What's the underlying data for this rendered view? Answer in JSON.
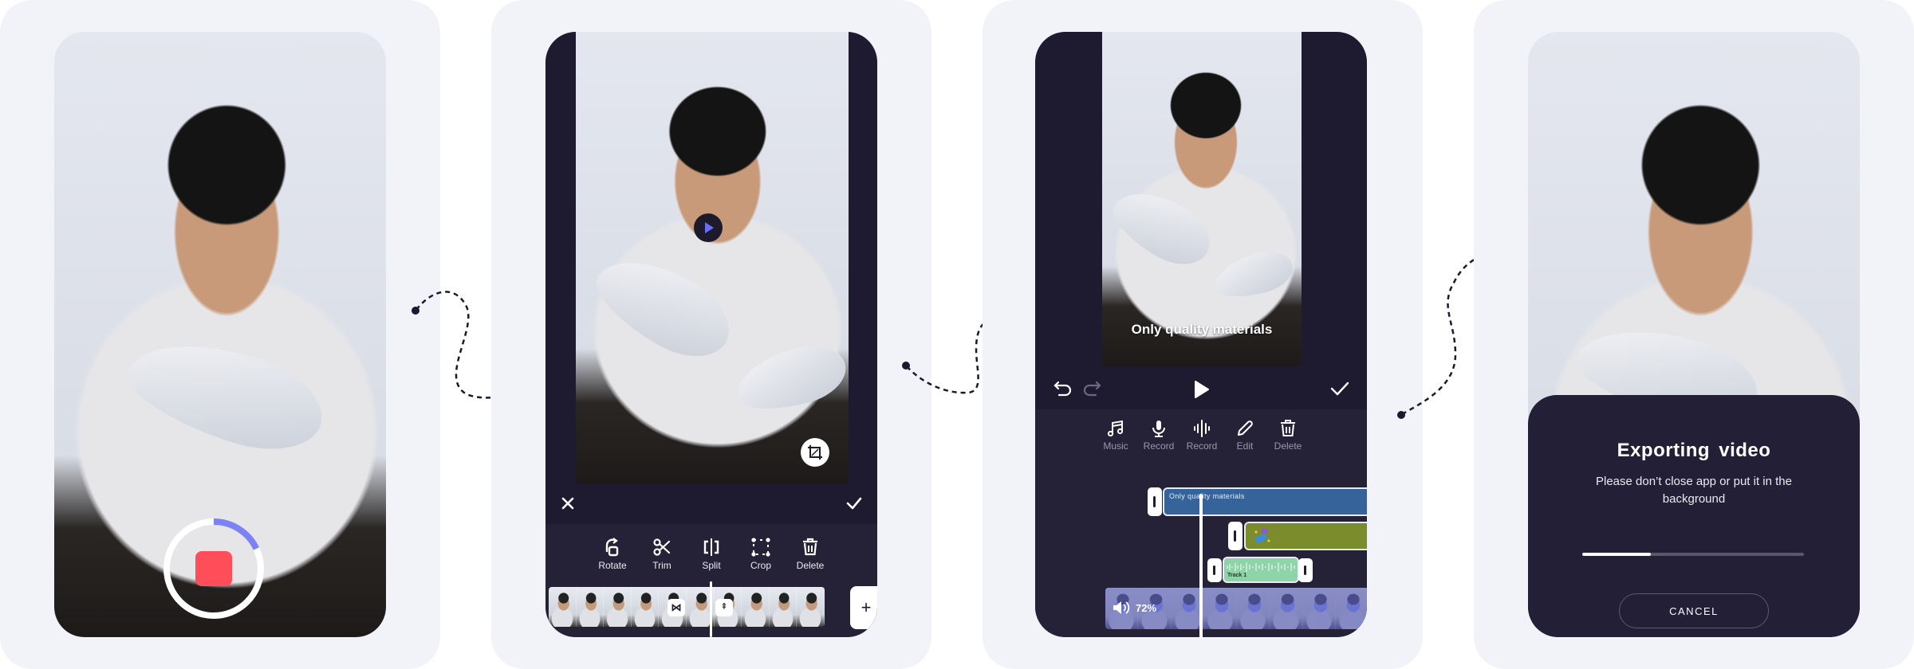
{
  "screens": {
    "record": {
      "recording_progress": 0.18,
      "colors": {
        "stop": "#ff4d5a",
        "ring": "#ffffff",
        "progress": "#7b82f5"
      }
    },
    "edit": {
      "tools": [
        {
          "icon": "rotate-icon",
          "label": "Rotate"
        },
        {
          "icon": "scissors-icon",
          "label": "Trim"
        },
        {
          "icon": "split-icon",
          "label": "Split"
        },
        {
          "icon": "crop-icon",
          "label": "Crop"
        },
        {
          "icon": "trash-icon",
          "label": "Delete"
        }
      ],
      "add_label": "+"
    },
    "audio": {
      "caption": "Only quality materials",
      "tools": [
        {
          "icon": "music-icon",
          "label": "Music"
        },
        {
          "icon": "microphone-icon",
          "label": "Record"
        },
        {
          "icon": "waveform-icon",
          "label": "Record"
        },
        {
          "icon": "pencil-icon",
          "label": "Edit"
        },
        {
          "icon": "trash-icon",
          "label": "Delete"
        }
      ],
      "text_track_label": "Only quality materials",
      "audio_track_label": "Track 1",
      "volume_label": "72%",
      "colors": {
        "text_track": "#35639a",
        "sticker_track": "#7a8c2c",
        "audio_track": "#8fd3a9",
        "video_track": "#7b7fd8"
      }
    },
    "export": {
      "title": "Exporting  video",
      "subtitle": "Please don’t close app or put it in the background",
      "progress": 0.31,
      "cancel_label": "CANCEL"
    }
  }
}
